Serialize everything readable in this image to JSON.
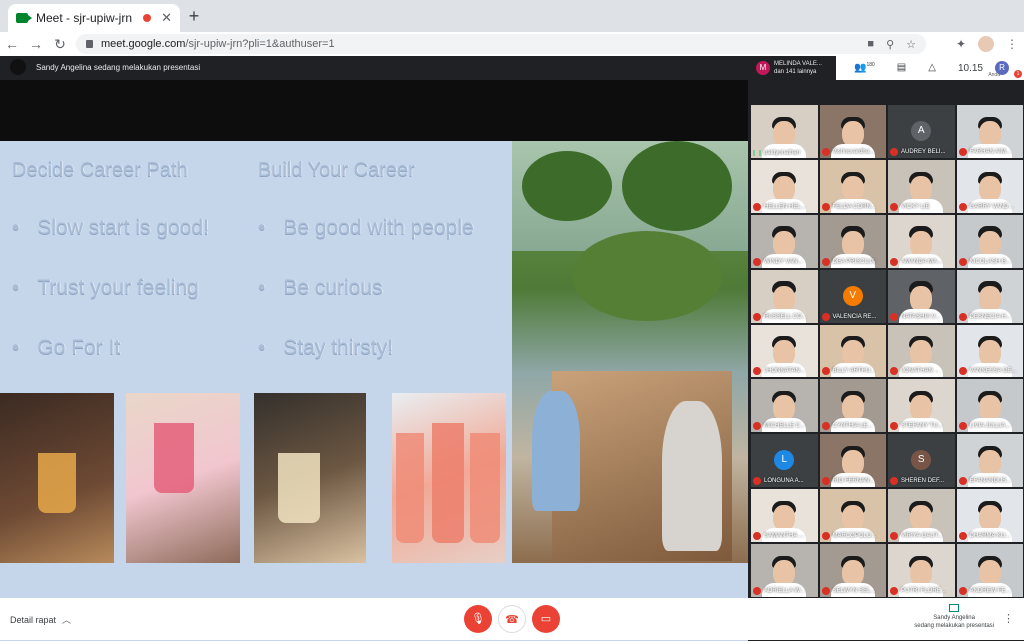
{
  "browser": {
    "tab_title": "Meet - sjr-upiw-jrn",
    "tab_close": "✕",
    "new_tab": "+",
    "url_host": "meet.google.com",
    "url_path": "/sjr-upiw-jrn?pli=1&authuser=1"
  },
  "meeting": {
    "presenter_status": "Sandy Angelina sedang melakukan presentasi",
    "participants_initial": "M",
    "participants_name": "MELINDA VALE...",
    "participants_more": "dan 141 lainnya",
    "people_count": "180",
    "time": "10.15",
    "me_initial": "R",
    "me_label": "Anda",
    "notification_count": "1"
  },
  "slide": {
    "left_heading": "Decide Career Path",
    "left_items": [
      "Slow start is good!",
      "Trust your feeling",
      "Go For It"
    ],
    "right_heading": "Build Your Career",
    "right_items": [
      "Be good with people",
      "Be curious",
      "Stay thirsty!"
    ]
  },
  "participants": [
    {
      "name": "paldyonathan",
      "speaking": true,
      "initial": ""
    },
    {
      "name": "Vishnuvardha...",
      "initial": ""
    },
    {
      "name": "AUDREY BELI...",
      "initial": "A",
      "color": "#5f6368"
    },
    {
      "name": "FARHAN AIM...",
      "initial": ""
    },
    {
      "name": "HELLEN HEL...",
      "initial": ""
    },
    {
      "name": "FELDA CORN...",
      "initial": ""
    },
    {
      "name": "VICKY LIE",
      "initial": ""
    },
    {
      "name": "GARRY VAND...",
      "initial": ""
    },
    {
      "name": "WINDY VAN...",
      "initial": ""
    },
    {
      "name": "DEA PRISCILIA",
      "initial": ""
    },
    {
      "name": "AMANDA MA...",
      "initial": ""
    },
    {
      "name": "NICOLASH B...",
      "initial": ""
    },
    {
      "name": "RUSSELL CO...",
      "initial": ""
    },
    {
      "name": "VALENCIA RE...",
      "initial": "V",
      "color": "#f57c00"
    },
    {
      "name": "NATASHIA V...",
      "initial": ""
    },
    {
      "name": "DESNECIA H...",
      "initial": ""
    },
    {
      "name": "JHONNATAN...",
      "initial": ""
    },
    {
      "name": "BILLY ARTHU...",
      "initial": ""
    },
    {
      "name": "JONATHAN ...",
      "initial": ""
    },
    {
      "name": "VANNESSA DE...",
      "initial": ""
    },
    {
      "name": "MICHELLE C...",
      "initial": ""
    },
    {
      "name": "CYNTHIA LE...",
      "initial": ""
    },
    {
      "name": "STEFANY TU...",
      "initial": ""
    },
    {
      "name": "LIVIA JULLIA...",
      "initial": ""
    },
    {
      "name": "LONGUNA A...",
      "initial": "L",
      "color": "#1e88e5"
    },
    {
      "name": "RIO FERNAN...",
      "initial": ""
    },
    {
      "name": "SHEREN DEF...",
      "initial": "S",
      "color": "#795548"
    },
    {
      "name": "EFANANDUS...",
      "initial": ""
    },
    {
      "name": "SAMANTHA ...",
      "initial": ""
    },
    {
      "name": "MARCOPOLO...",
      "initial": ""
    },
    {
      "name": "VIRIYA GAUT...",
      "initial": ""
    },
    {
      "name": "DHARMA KU...",
      "initial": ""
    },
    {
      "name": "ADRIELLA W...",
      "initial": ""
    },
    {
      "name": "SELWYN SEL...",
      "initial": ""
    },
    {
      "name": "PUTRI FLORE...",
      "initial": ""
    },
    {
      "name": "ANDREW FE...",
      "initial": ""
    }
  ],
  "bottom": {
    "details_label": "Detail rapat",
    "present_line1": "Sandy Angelina",
    "present_line2": "sedang melakukan presentasi"
  },
  "icons": [
    "meet-logo-icon",
    "record-icon",
    "back-icon",
    "forward-icon",
    "reload-icon",
    "lock-icon",
    "camera-icon",
    "zoom-icon",
    "star-icon",
    "extensions-icon",
    "more-vert-icon",
    "people-icon",
    "chat-icon",
    "activities-icon",
    "mic-off-icon",
    "hangup-icon",
    "camera-off-icon",
    "present-icon",
    "chevron-up-icon"
  ],
  "colors": {
    "danger": "#ea4335",
    "meet_dark": "#202124",
    "slide_bg": "#c5d5ea"
  }
}
